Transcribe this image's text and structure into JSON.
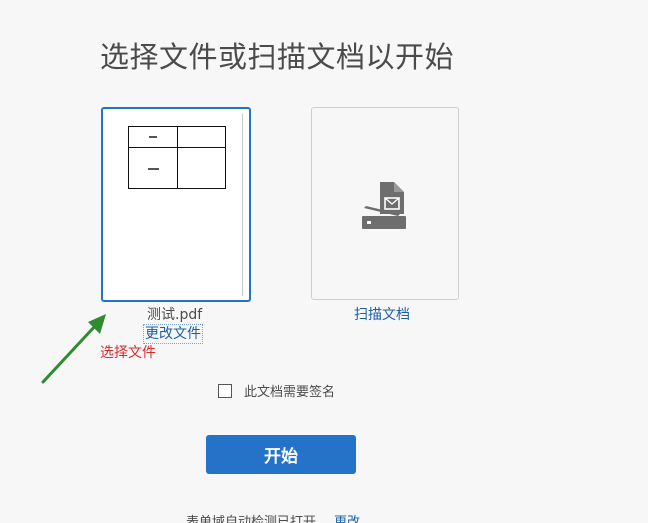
{
  "title": "选择文件或扫描文档以开始",
  "file": {
    "name": "测试.pdf",
    "change_label": "更改文件"
  },
  "scan": {
    "label": "扫描文档",
    "icon": "scanner-document-icon"
  },
  "annotation": {
    "label": "选择文件",
    "color": "#d92b2b",
    "arrow_color": "#2e8b2e"
  },
  "sign": {
    "label": "此文档需要签名",
    "checked": false
  },
  "start_button": {
    "label": "开始"
  },
  "footer": {
    "text": "表单域自动检测已打开",
    "link": "更改"
  },
  "colors": {
    "accent": "#2473c8",
    "link": "#1a5fa8",
    "background": "#f7f7f7",
    "text": "#4b4b4b"
  }
}
